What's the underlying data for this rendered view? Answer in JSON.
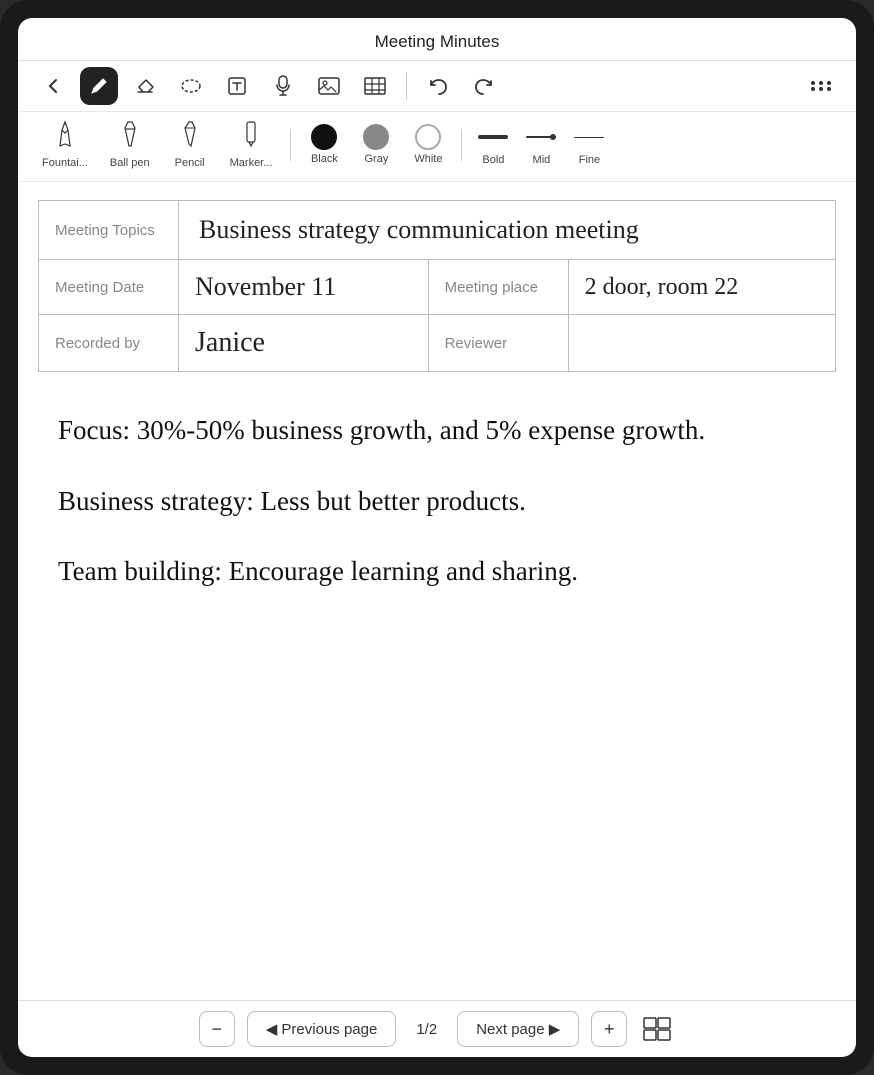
{
  "app": {
    "title": "Meeting Minutes"
  },
  "toolbar": {
    "back_label": "←",
    "pen_label": "✒",
    "eraser_label": "◻",
    "lasso_label": "⬭",
    "text_label": "T",
    "mic_label": "🎤",
    "image_label": "🖼",
    "table_label": "⊞",
    "undo_label": "↩",
    "redo_label": "↪",
    "more_label": "⋮⋮"
  },
  "pen_options": {
    "fountain_label": "Fountai...",
    "ballpen_label": "Ball pen",
    "pencil_label": "Pencil",
    "marker_label": "Marker...",
    "black_label": "Black",
    "gray_label": "Gray",
    "white_label": "White",
    "bold_label": "Bold",
    "mid_label": "Mid",
    "fine_label": "Fine"
  },
  "table": {
    "rows": [
      {
        "label": "Meeting Topics",
        "value": "Business strategy communication meeting",
        "colspan": true
      },
      {
        "label": "Meeting Date",
        "value": "November 11",
        "extra_label": "Meeting place",
        "extra_value": "2 door, room 22"
      },
      {
        "label": "Recorded by",
        "value": "Janice",
        "extra_label": "Reviewer",
        "extra_value": ""
      }
    ]
  },
  "notes": {
    "lines": [
      "Focus: 30%-50% business growth, and 5% expense growth.",
      "Business strategy: Less but better products.",
      "Team building: Encourage learning and sharing."
    ]
  },
  "pagination": {
    "previous_label": "◀  Previous page",
    "page_info": "1/2",
    "next_label": "Next page  ▶",
    "minus_label": "−",
    "plus_label": "+"
  }
}
